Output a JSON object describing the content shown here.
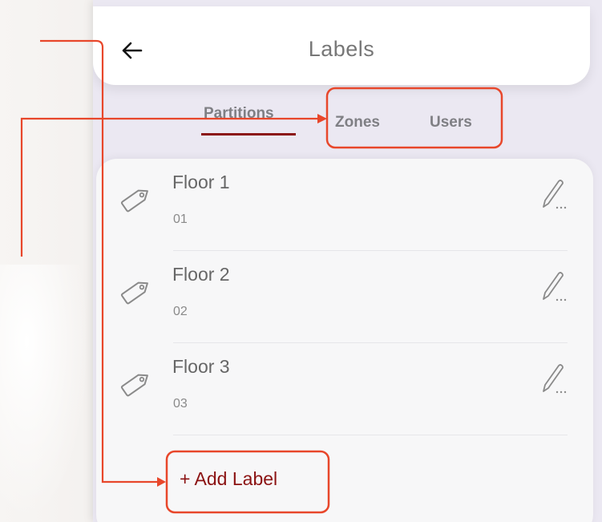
{
  "header": {
    "title": "Labels",
    "back_icon": "arrow-left-icon"
  },
  "tabs": [
    {
      "label": "Partitions",
      "active": true
    },
    {
      "label": "Zones",
      "active": false
    },
    {
      "label": "Users",
      "active": false
    }
  ],
  "labels": [
    {
      "name": "Floor 1",
      "code": "01"
    },
    {
      "name": "Floor 2",
      "code": "02"
    },
    {
      "name": "Floor 3",
      "code": "03"
    }
  ],
  "add_label": "+ Add Label",
  "colors": {
    "accent": "#8b1515",
    "annotation": "#e8472b",
    "background": "#ebe8f2"
  }
}
